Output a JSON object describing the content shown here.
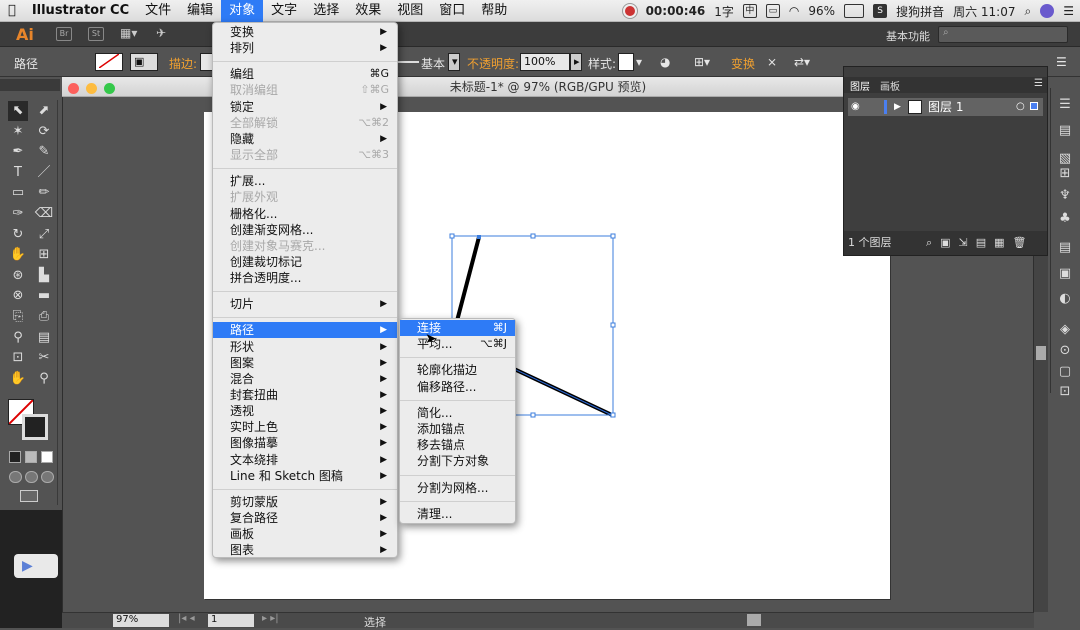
{
  "menubar": {
    "app": "Illustrator CC",
    "items": [
      "文件",
      "编辑",
      "对象",
      "文字",
      "选择",
      "效果",
      "视图",
      "窗口",
      "帮助"
    ],
    "active": "对象",
    "status": {
      "timer": "00:00:46",
      "input_mode": "1字",
      "ime": "中",
      "battery": "96%",
      "input_method": "搜狗拼音",
      "clock": "周六 11:07"
    }
  },
  "appbar": {
    "logo": "Ai",
    "icon_br": "Br",
    "icon_st": "St",
    "workspace": "基本功能"
  },
  "control": {
    "selection_label": "路径",
    "stroke_label": "描边:",
    "stroke_profile": "基本",
    "opacity_label": "不透明度:",
    "opacity_value": "100%",
    "style_label": "样式:",
    "transform_label": "变换"
  },
  "document": {
    "title": "未标题-1* @ 97% (RGB/GPU 预览)",
    "zoom": "97%",
    "page": "1",
    "status": "选择"
  },
  "layers_panel": {
    "tab1": "图层",
    "tab2": "画板",
    "layer_name": "图层 1",
    "footer": "1 个图层"
  },
  "object_menu": {
    "items": [
      {
        "label": "变换",
        "arrow": true
      },
      {
        "label": "排列",
        "arrow": true
      },
      {
        "sep": true
      },
      {
        "label": "编组",
        "shortcut": "⌘G"
      },
      {
        "label": "取消编组",
        "shortcut": "⇧⌘G",
        "disabled": true
      },
      {
        "label": "锁定",
        "arrow": true
      },
      {
        "label": "全部解锁",
        "shortcut": "⌥⌘2",
        "disabled": true
      },
      {
        "label": "隐藏",
        "arrow": true
      },
      {
        "label": "显示全部",
        "shortcut": "⌥⌘3",
        "disabled": true
      },
      {
        "sep": true
      },
      {
        "label": "扩展..."
      },
      {
        "label": "扩展外观",
        "disabled": true
      },
      {
        "label": "栅格化..."
      },
      {
        "label": "创建渐变网格..."
      },
      {
        "label": "创建对象马赛克...",
        "disabled": true
      },
      {
        "label": "创建裁切标记"
      },
      {
        "label": "拼合透明度..."
      },
      {
        "sep": true
      },
      {
        "label": "切片",
        "arrow": true
      },
      {
        "sep": true
      },
      {
        "label": "路径",
        "arrow": true,
        "highlighted": true
      },
      {
        "label": "形状",
        "arrow": true
      },
      {
        "label": "图案",
        "arrow": true
      },
      {
        "label": "混合",
        "arrow": true
      },
      {
        "label": "封套扭曲",
        "arrow": true
      },
      {
        "label": "透视",
        "arrow": true
      },
      {
        "label": "实时上色",
        "arrow": true
      },
      {
        "label": "图像描摹",
        "arrow": true
      },
      {
        "label": "文本绕排",
        "arrow": true
      },
      {
        "label": "Line 和 Sketch 图稿",
        "arrow": true
      },
      {
        "sep": true
      },
      {
        "label": "剪切蒙版",
        "arrow": true
      },
      {
        "label": "复合路径",
        "arrow": true
      },
      {
        "label": "画板",
        "arrow": true
      },
      {
        "label": "图表",
        "arrow": true
      }
    ]
  },
  "path_submenu": {
    "items": [
      {
        "label": "连接",
        "shortcut": "⌘J",
        "highlighted": true
      },
      {
        "label": "平均...",
        "shortcut": "⌥⌘J"
      },
      {
        "sep": true
      },
      {
        "label": "轮廓化描边"
      },
      {
        "label": "偏移路径..."
      },
      {
        "sep": true
      },
      {
        "label": "简化..."
      },
      {
        "label": "添加锚点"
      },
      {
        "label": "移去锚点"
      },
      {
        "label": "分割下方对象"
      },
      {
        "sep": true
      },
      {
        "label": "分割为网格..."
      },
      {
        "sep": true
      },
      {
        "label": "清理..."
      }
    ]
  },
  "colors": {
    "accent": "#2e7bf6",
    "ui_bg": "#535353",
    "menu_bg": "#ececec",
    "stroke": "#000000"
  }
}
